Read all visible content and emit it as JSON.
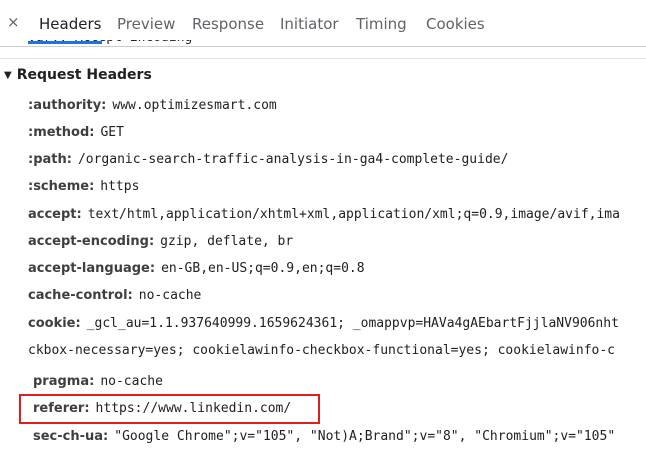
{
  "tabs": {
    "close": "×",
    "items": [
      "Headers",
      "Preview",
      "Response",
      "Initiator",
      "Timing",
      "Cookies"
    ]
  },
  "peek_text": "vary: Accept-Encoding",
  "section": {
    "title": "Request Headers"
  },
  "headers": [
    {
      "key": ":authority:",
      "value": "www.optimizesmart.com"
    },
    {
      "key": ":method:",
      "value": "GET"
    },
    {
      "key": ":path:",
      "value": "/organic-search-traffic-analysis-in-ga4-complete-guide/"
    },
    {
      "key": ":scheme:",
      "value": "https"
    },
    {
      "key": "accept:",
      "value": "text/html,application/xhtml+xml,application/xml;q=0.9,image/avif,ima"
    },
    {
      "key": "accept-encoding:",
      "value": "gzip, deflate, br"
    },
    {
      "key": "accept-language:",
      "value": "en-GB,en-US;q=0.9,en;q=0.8"
    },
    {
      "key": "cache-control:",
      "value": "no-cache"
    },
    {
      "key": "cookie:",
      "value": "_gcl_au=1.1.937640999.1659624361; _omappvp=HAVa4gAEbartFjjlaNV906nht"
    },
    {
      "key": "",
      "value": "ckbox-necessary=yes; cookielawinfo-checkbox-functional=yes; cookielawinfo-c"
    },
    {
      "key": "pragma:",
      "value": "no-cache"
    },
    {
      "key": "referer:",
      "value": "https://www.linkedin.com/"
    },
    {
      "key": "sec-ch-ua:",
      "value": "\"Google Chrome\";v=\"105\", \"Not)A;Brand\";v=\"8\", \"Chromium\";v=\"105\""
    }
  ],
  "colors": {
    "highlight": "#e01e1e",
    "active_tab_underline": "#1a73e8"
  }
}
